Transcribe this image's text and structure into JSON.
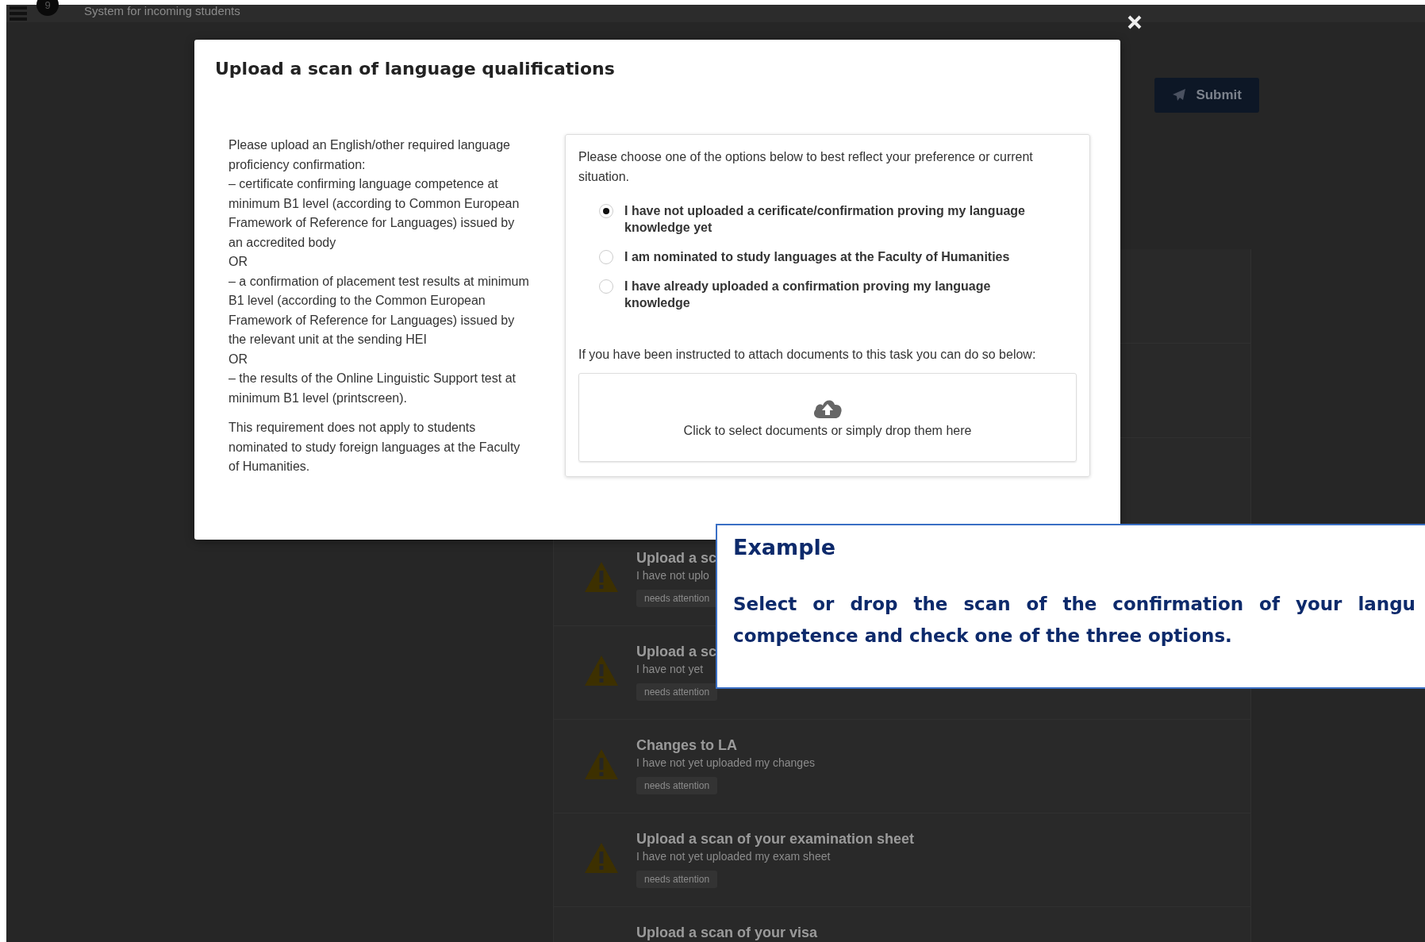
{
  "topbar": {
    "badge": "9",
    "title": "System for incoming students"
  },
  "toolbar": {
    "submit": "Submit"
  },
  "tasks": [
    {
      "kind": "attention",
      "title": "Upload a sc",
      "subtitle": "I have not uplo",
      "status": "needs attention"
    },
    {
      "kind": "attention",
      "title": "Upload a sc",
      "subtitle": "I have not yet",
      "status": "needs attention"
    },
    {
      "kind": "attention",
      "title": "Changes to LA",
      "subtitle": "I have not yet uploaded my changes",
      "status": "needs attention"
    },
    {
      "kind": "attention",
      "title": "Upload a scan of your examination sheet",
      "subtitle": "I have not yet uploaded my exam sheet",
      "status": "needs attention"
    },
    {
      "kind": "partial",
      "title": "Upload a scan of your visa"
    }
  ],
  "modal": {
    "title": "Upload a scan of language qualifications",
    "instructions": [
      "Please upload an English/other required language proficiency confirmation:",
      "– certificate confirming language competence at minimum B1 level (according to Common European Framework of Reference for Languages) issued by an accredited body",
      "OR",
      "– a confirmation of placement test results at minimum B1 level (according to the Common European Framework of Reference for Languages) issued by the relevant unit at the sending HEI",
      "OR",
      "– the results of the Online Linguistic Support test at minimum B1 level (printscreen)."
    ],
    "note": "This requirement does not apply to students nominated to study foreign languages at the Faculty of Humanities.",
    "prompt": "Please choose one of the options below to best reflect your preference or current situation.",
    "options": [
      {
        "label": "I have not uploaded a cerificate/confirmation proving my language knowledge yet",
        "selected": true
      },
      {
        "label": "I am nominated to study languages at the Faculty of Humanities",
        "selected": false
      },
      {
        "label": "I have already uploaded a confirmation proving my language knowledge",
        "selected": false
      }
    ],
    "attach_hint": "If you have been instructed to attach documents to this task you can do so below:",
    "dropzone": "Click to select documents or simply drop them here"
  },
  "tooltip": {
    "title": "Example",
    "lines": [
      "Select or drop the scan of the confirmation of your langu",
      "competence and check one of the three options."
    ]
  }
}
